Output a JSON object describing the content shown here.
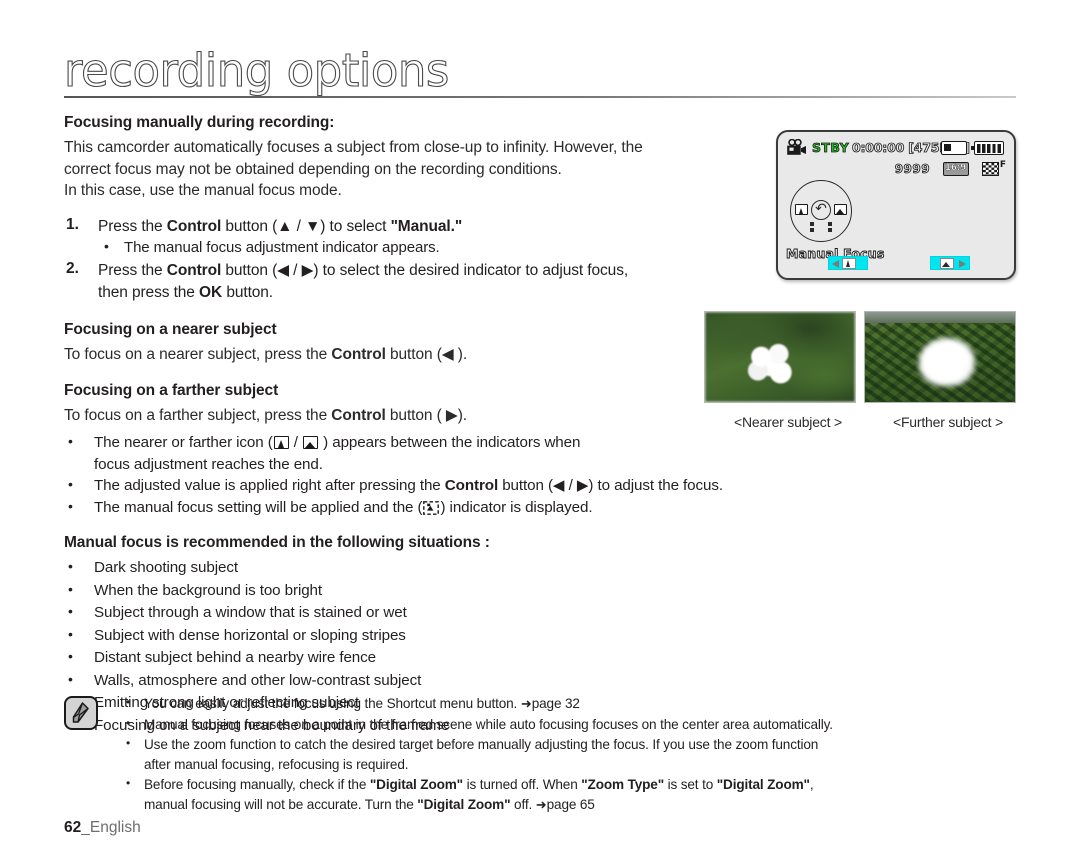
{
  "header": {
    "chapter_title": "recording options"
  },
  "section_intro": {
    "heading": "Focusing manually during recording:",
    "paragraph_line1": "This camcorder automatically focuses a subject from close-up to infinity. However, the",
    "paragraph_line2": "correct focus may not be obtained depending on the recording conditions.",
    "paragraph_line3": "In this case, use the manual focus mode."
  },
  "steps": [
    {
      "num": "1.",
      "text_before": "Press the ",
      "bold1": "Control",
      "text_mid": " button (▲ / ▼) to select ",
      "bold2": "\"Manual.\"",
      "sub_bullets": [
        "The manual focus adjustment indicator appears."
      ]
    },
    {
      "num": "2.",
      "text_before": "Press the ",
      "bold1": "Control",
      "text_mid": " button (◀ / ▶) to select the desired indicator to adjust focus,",
      "line2_before": "then press the ",
      "line2_bold": "OK",
      "line2_after": " button."
    }
  ],
  "nearer": {
    "heading": "Focusing on a nearer subject",
    "text_before": "To focus on a nearer subject, press the ",
    "bold": "Control",
    "text_after": " button (◀ )."
  },
  "farther": {
    "heading": "Focusing on a farther subject",
    "text_before": "To focus on a farther subject, press the ",
    "bold": "Control",
    "text_after": " button ( ▶)."
  },
  "focus_bullets": {
    "b1_part1": "The nearer or farther icon (",
    "b1_sep": " / ",
    "b1_part2": " ) appears between the indicators when",
    "b1_line2": "focus adjustment reaches the end.",
    "b2_part1": "The adjusted value is applied right after pressing the ",
    "b2_bold": "Control",
    "b2_part2": " button (◀ / ▶) to adjust the focus.",
    "b3_part1": "The manual focus setting will be applied and the (",
    "b3_part2": ") indicator is displayed."
  },
  "recommended": {
    "heading": "Manual focus is recommended in the following situations :",
    "items": [
      "Dark shooting subject",
      "When the background is too bright",
      "Subject through a window that is stained or wet",
      "Subject with dense horizontal or sloping stripes",
      "Distant subject behind a nearby wire fence",
      "Walls, atmosphere and other low-contrast subject",
      "Emitting strong light or reflecting subject",
      "Focusing on a subject near the boundary of the frame"
    ]
  },
  "lcd": {
    "status": "STBY",
    "timecode": "0:00:00",
    "remaining": "[475Min]",
    "counter": "9999",
    "ratio_label": "16:9",
    "quality_label": "F",
    "mode_label": "Manual Focus",
    "colors": {
      "status_green": "#22c022",
      "indicator_cyan": "#00e5f0",
      "screen_bg": "#e9e9e9"
    }
  },
  "photos": {
    "caption_left": "<Nearer subject >",
    "caption_right": "<Further subject >"
  },
  "note": {
    "items": [
      {
        "part1": "You can easily adjust the focus using the Shortcut menu button. ",
        "arrow": "➜",
        "part2": "page 32"
      },
      {
        "part1": "Manual focusing focuses on a point in the framed scene while auto focusing focuses on the center area automatically."
      },
      {
        "part1": "Use the zoom function to catch the desired target before manually adjusting the focus. If you use the zoom function",
        "line2": "after manual focusing, refocusing is required."
      },
      {
        "part1": "Before focusing manually, check if the ",
        "bold1": "\"Digital Zoom\"",
        "part2": " is turned off. When ",
        "bold2": "\"Zoom Type\"",
        "part3": " is set to ",
        "bold3": "\"Digital Zoom\"",
        "part4": ",",
        "line2_part1": "manual focusing will not be accurate. Turn the ",
        "line2_bold": "\"Digital Zoom\"",
        "line2_part2": " off. ",
        "line2_arrow": "➜",
        "line2_part3": "page 65"
      }
    ]
  },
  "footer": {
    "page_number": "62",
    "language": "_English"
  }
}
